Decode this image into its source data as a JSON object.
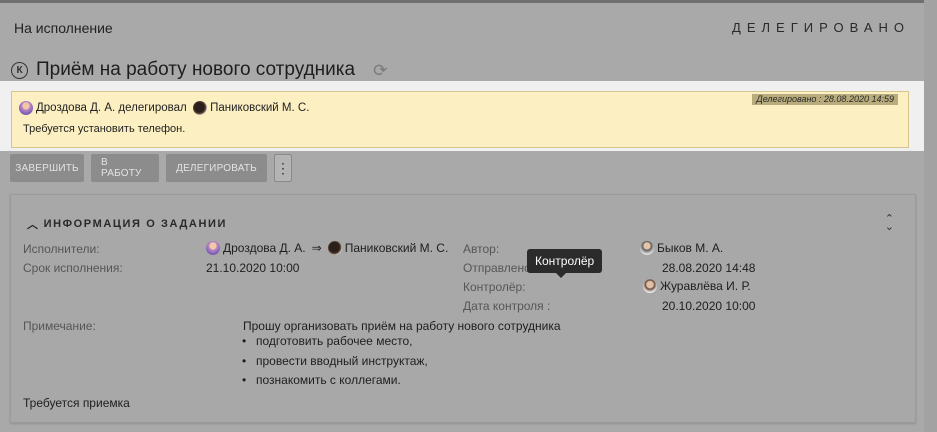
{
  "header": {
    "status": "На исполнение",
    "state": "ДЕЛЕГИРОВАНО"
  },
  "task": {
    "k_letter": "К",
    "title": "Приём на работу нового сотрудника"
  },
  "note": {
    "stamp": "Делегировано : 28.08.2020 14:59",
    "from": "Дроздова Д. А.",
    "action": "делегировал",
    "to": "Паниковский М. С.",
    "message": "Требуется установить телефон."
  },
  "toolbar": {
    "complete": "ЗАВЕРШИТЬ",
    "in_work": "В РАБОТУ",
    "delegate": "ДЕЛЕГИРОВАТЬ",
    "more": "⋮"
  },
  "info": {
    "heading": "ИНФОРМАЦИЯ О ЗАДАНИИ",
    "executors_label": "Исполнители:",
    "executor_from": "Дроздова Д. А.",
    "arrow": "⇒",
    "executor_to": "Паниковский М. С.",
    "deadline_label": "Срок исполнения:",
    "deadline_value": "21.10.2020 10:00",
    "author_label": "Автор:",
    "author_value": "Быков М. А.",
    "sent_label": "Отправлено:",
    "sent_value": "28.08.2020 14:48",
    "controller_label": "Контролёр:",
    "controller_value": "Журавлёва И. Р.",
    "control_date_label": "Дата контроля :",
    "control_date_value": "20.10.2020 10:00",
    "note_label": "Примечание:",
    "note_text": "Прошу организовать приём на работу нового сотрудника",
    "bullets": [
      "подготовить рабочее место,",
      "провести вводный инструктаж,",
      "познакомить с коллегами."
    ],
    "footer": "Требуется приемка"
  },
  "tooltip": {
    "text": "Контролёр"
  }
}
